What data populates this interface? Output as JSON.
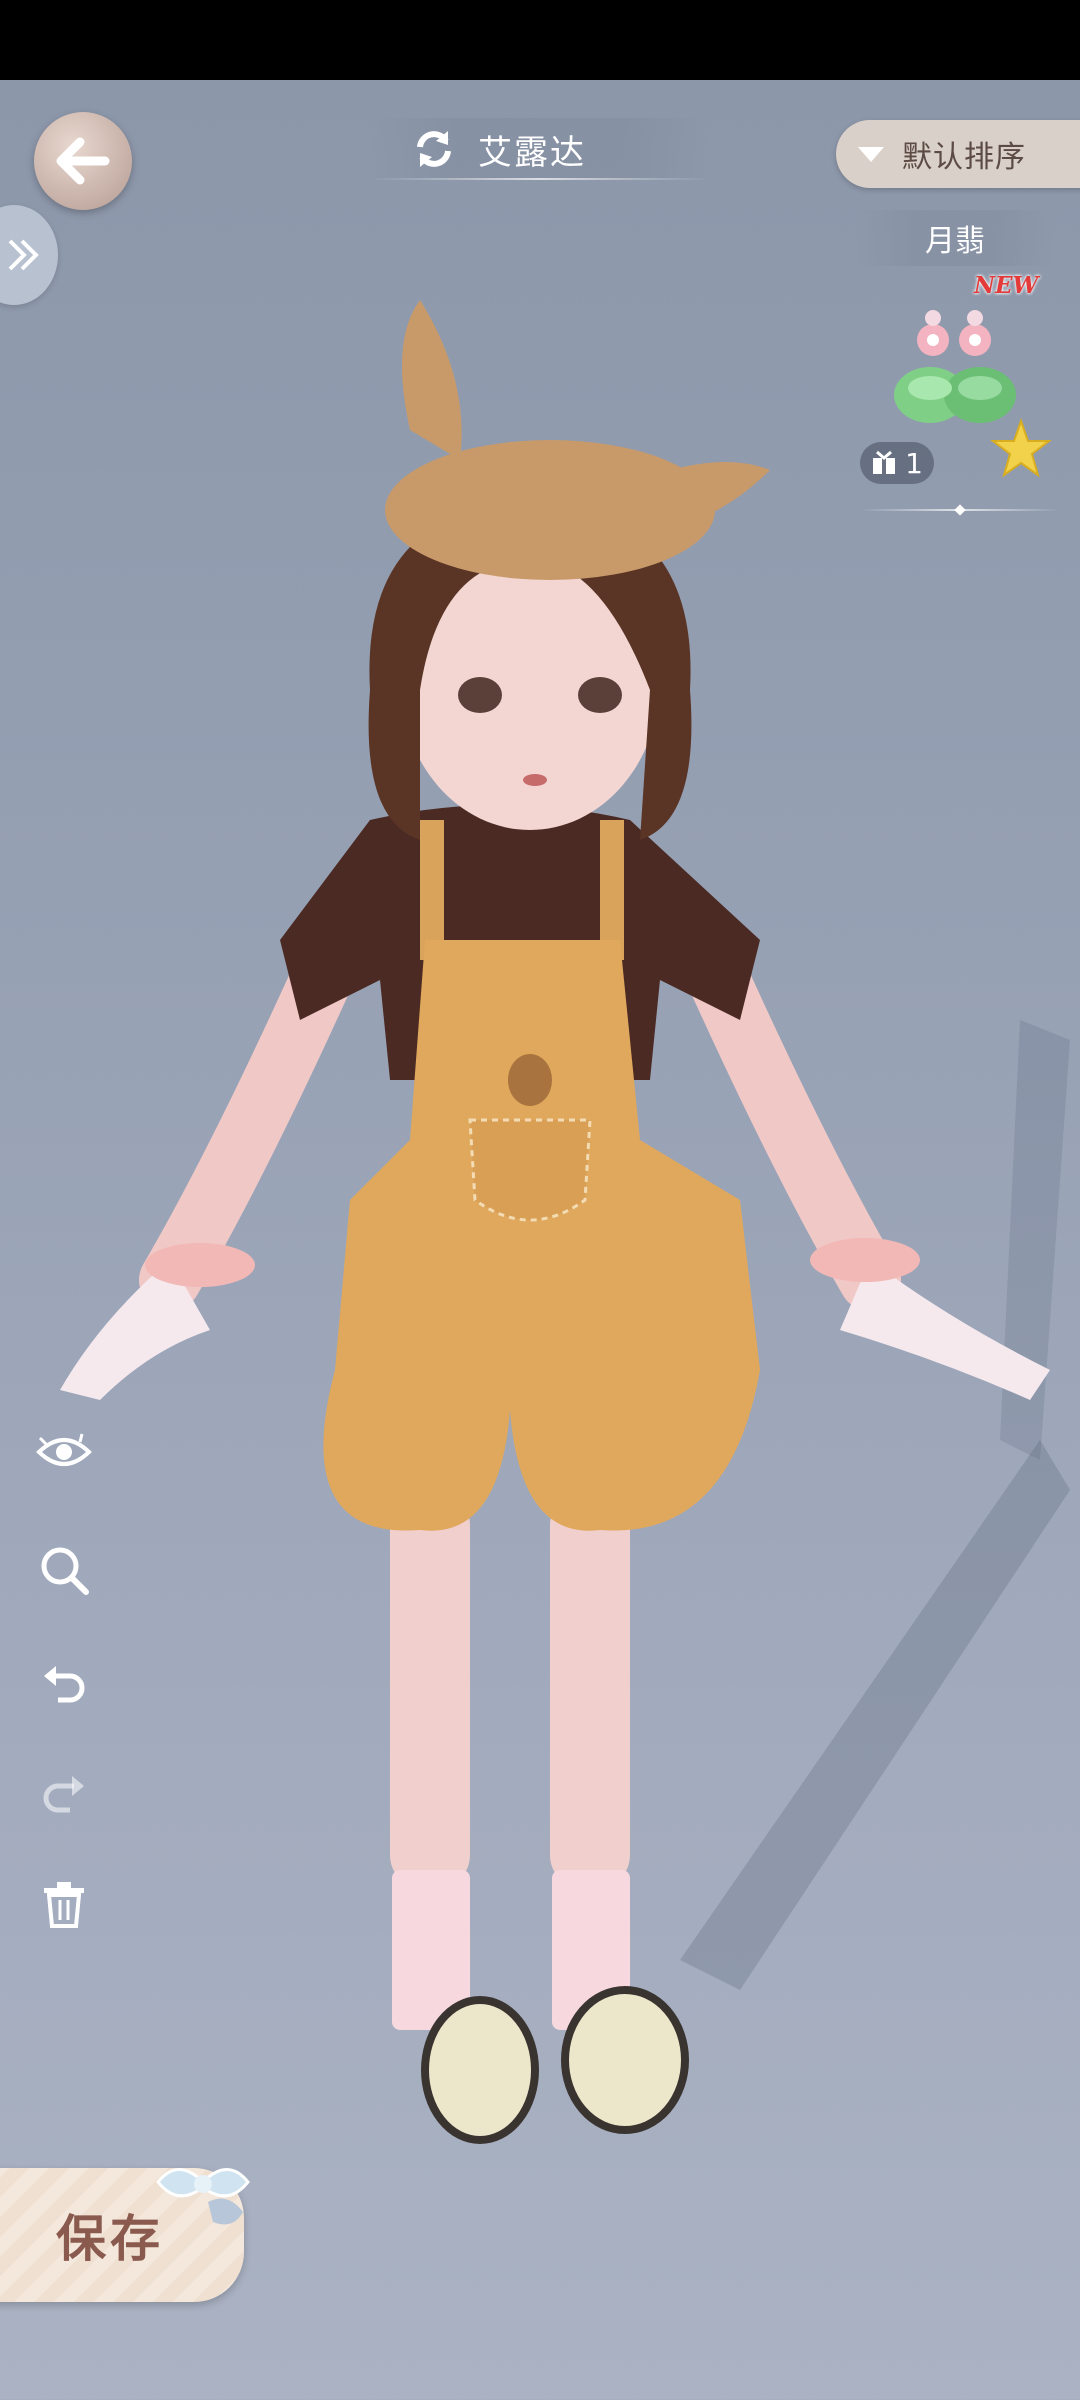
{
  "header": {
    "character_name": "艾露达",
    "sort_label": "默认排序"
  },
  "item": {
    "name": "月翡",
    "badge": "NEW",
    "count": "1"
  },
  "save_label": "保存",
  "icons": {
    "back": "back-arrow-icon",
    "expand": "double-chevron-right-icon",
    "switch": "refresh-icon",
    "sort": "triangle-down-icon",
    "gift": "gift-box-icon",
    "star": "star-icon",
    "tools": [
      "eye-icon",
      "zoom-icon",
      "undo-icon",
      "redo-icon",
      "trash-icon"
    ]
  },
  "colors": {
    "background": "#97a1b4",
    "sort_button": "#d9d0c9",
    "new_badge": "#e43a3a",
    "save_text": "#8a5a4e"
  }
}
